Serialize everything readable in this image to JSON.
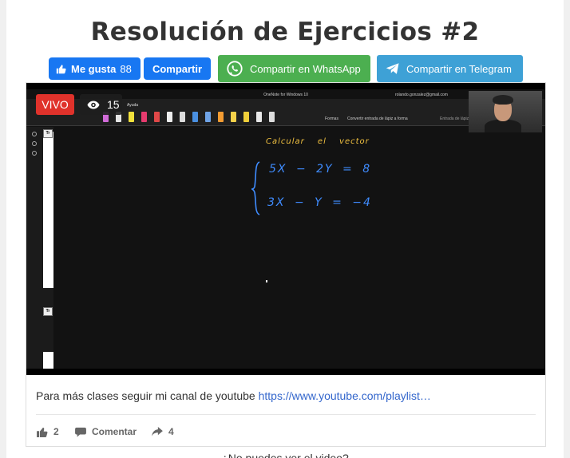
{
  "page": {
    "title": "Resolución de Ejercicios #2"
  },
  "share": {
    "fb_like_label": "Me gusta",
    "fb_like_count": "88",
    "fb_share_label": "Compartir",
    "whatsapp_label": "Compartir en WhatsApp",
    "telegram_label": "Compartir en Telegram",
    "colors": {
      "facebook": "#1877f2",
      "whatsapp": "#4caf50",
      "telegram": "#3ea1d6"
    }
  },
  "video": {
    "live_label": "VIVO",
    "live_color": "#e0322b",
    "viewer_count": "15",
    "onenote": {
      "app_title": "OneNote for Windows 10",
      "email": "rolando.gonzalez@gmail.com",
      "tab": "Ayuda",
      "tool_formas": "Formas",
      "tool_convert": "Convertir entrada de lápiz a forma",
      "tool_math": "Entrada de lápiz",
      "page_icon": "Tr",
      "handwriting_title": "Calcular el vector",
      "equation_1": "5X − 2Y = 8",
      "equation_2": "3X − Y = −4"
    }
  },
  "post": {
    "description": "Para más clases seguir mi canal de youtube ",
    "link_text": "https://www.youtube.com/playlist…",
    "likes": "2",
    "comment_label": "Comentar",
    "shares": "4",
    "accent_link": "#3366cc"
  },
  "footer": {
    "cant_see_text": "¿No puedes ver el video?"
  }
}
